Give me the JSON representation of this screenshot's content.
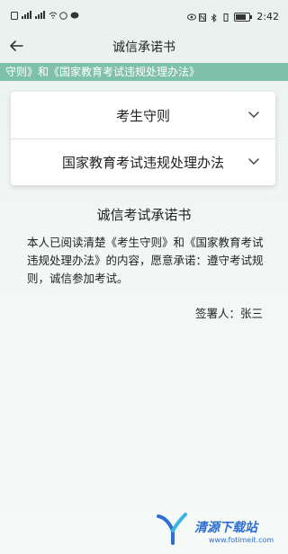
{
  "status_bar": {
    "time": "2:42"
  },
  "header": {
    "title": "诚信承诺书"
  },
  "marquee": {
    "text": "守则》和《国家教育考试违规处理办法》"
  },
  "menu": {
    "items": [
      {
        "label": "考生守则"
      },
      {
        "label": "国家教育考试违规处理办法"
      }
    ]
  },
  "pledge": {
    "title": "诚信考试承诺书",
    "body": "本人已阅读清楚《考生守则》和《国家教育考试违规处理办法》的内容，愿意承诺：遵守考试规则，诚信参加考试。",
    "signature": "签署人：张三"
  },
  "watermark": {
    "text": "清源下载站",
    "url": "www.fotimeit.com"
  },
  "colors": {
    "marquee_bg": "#7ec0aa",
    "watermark": "#2e6fd1"
  }
}
